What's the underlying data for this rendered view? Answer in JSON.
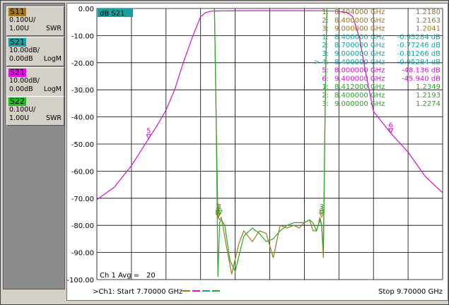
{
  "side_panel": {
    "traces": [
      {
        "name": "S11",
        "scale": "0.100U/",
        "ref": "1.00U",
        "format": "SWR",
        "color": "#a47a1c"
      },
      {
        "name": "S21",
        "scale": "10.00dB/",
        "ref": "0.00dB",
        "format": "LogM",
        "color": "#1aa0a0"
      },
      {
        "name": "S21",
        "scale": "10.00dB/",
        "ref": "0.00dB",
        "format": "LogM",
        "color": "#e010e0"
      },
      {
        "name": "S22",
        "scale": "0.100U/",
        "ref": "1.00U",
        "format": "SWR",
        "color": "#22bb22"
      }
    ]
  },
  "plot": {
    "active_trace_label": "dB S21",
    "avg_label": "Ch 1 Avg =",
    "avg_value": "20",
    "start_label": ">Ch1:  Start  7.70000 GHz",
    "stop_label": "Stop  9.70000 GHz"
  },
  "markers": [
    {
      "id": "1:",
      "freq": "8.404000 GHz",
      "value": "1.2180",
      "color": "#a0701a"
    },
    {
      "id": "2:",
      "freq": "8.400000 GHz",
      "value": "1.2163",
      "color": "#a0701a"
    },
    {
      "id": "3:",
      "freq": "9.000000 GHz",
      "value": "1.2041",
      "color": "#a0701a"
    },
    {
      "id": "1:",
      "freq": "8.400000 GHz",
      "value": "-0.95284 dB",
      "color": "#1aa0a0"
    },
    {
      "id": "2:",
      "freq": "8.700000 GHz",
      "value": "-0.77246 dB",
      "color": "#1aa0a0"
    },
    {
      "id": "3:",
      "freq": "9.000000 GHz",
      "value": "-0.81266 dB",
      "color": "#1aa0a0"
    },
    {
      "id": "> 4:",
      "freq": "8.400000 GHz",
      "value": "-0.95284 dB",
      "color": "#1aa0a0"
    },
    {
      "id": "5:",
      "freq": "8.000000 GHz",
      "value": "-48.136 dB",
      "color": "#e010e0"
    },
    {
      "id": "6:",
      "freq": "9.400000 GHz",
      "value": "-45.940 dB",
      "color": "#e010e0"
    },
    {
      "id": "1:",
      "freq": "8.412000 GHz",
      "value": "1.2349",
      "color": "#22aa22"
    },
    {
      "id": "2:",
      "freq": "8.400000 GHz",
      "value": "1.2193",
      "color": "#22aa22"
    },
    {
      "id": "3:",
      "freq": "9.000000 GHz",
      "value": "1.2274",
      "color": "#22aa22"
    }
  ],
  "chart_data": {
    "type": "line",
    "xlim": [
      7.7,
      9.7
    ],
    "ylim": [
      -100,
      0
    ],
    "y_ticks": [
      "0.00",
      "-10.00",
      "-20.00",
      "-30.00",
      "-40.00",
      "-50.00",
      "-60.00",
      "-70.00",
      "-80.00",
      "-90.00",
      "-100.00"
    ],
    "grid": true,
    "x_grid_divisions": 10,
    "series": [
      {
        "name": "S21",
        "color": "#d010d0",
        "x": [
          7.7,
          7.8,
          7.9,
          8.0,
          8.05,
          8.1,
          8.15,
          8.2,
          8.25,
          8.3,
          8.33,
          8.36,
          8.39,
          8.41,
          8.6,
          8.8,
          9.0,
          9.1,
          9.15,
          9.18,
          9.22,
          9.25,
          9.3,
          9.4,
          9.5,
          9.6,
          9.7
        ],
        "y": [
          -70.5,
          -66,
          -58,
          -48,
          -43,
          -37.5,
          -30,
          -20,
          -11,
          -3,
          -1.5,
          -1.0,
          -0.95,
          -0.9,
          -0.8,
          -0.8,
          -0.85,
          -1.0,
          -1.5,
          -3,
          -11,
          -22,
          -38,
          -46,
          -53,
          -62,
          -68
        ]
      },
      {
        "name": "S11",
        "color": "#a07818",
        "x": [
          8.38,
          8.39,
          8.4,
          8.41,
          8.42,
          8.45,
          8.48,
          8.52,
          8.55,
          8.6,
          8.64,
          8.68,
          8.72,
          8.76,
          8.8,
          8.84,
          8.87,
          8.9,
          8.93,
          8.95,
          8.97,
          8.98,
          8.99,
          9.0,
          9.01,
          9.02,
          9.03
        ],
        "y": [
          0,
          -40,
          -77,
          -78,
          -77,
          -88,
          -98,
          -87,
          -82,
          -86,
          -82,
          -83,
          -92,
          -80,
          -81,
          -80,
          -81,
          -79,
          -78,
          -82,
          -82,
          -80,
          -77,
          -80,
          -92,
          -40,
          0
        ]
      },
      {
        "name": "S22",
        "color": "#22aa22",
        "x": [
          8.38,
          8.39,
          8.4,
          8.41,
          8.42,
          8.44,
          8.47,
          8.5,
          8.55,
          8.6,
          8.64,
          8.68,
          8.72,
          8.76,
          8.8,
          8.84,
          8.87,
          8.9,
          8.93,
          8.95,
          8.97,
          8.98,
          8.99,
          9.0,
          9.01,
          9.02,
          9.03
        ],
        "y": [
          0,
          -40,
          -99,
          -79,
          -78,
          -80,
          -93,
          -97,
          -84,
          -81,
          -83,
          -86,
          -85,
          -82,
          -80,
          -79,
          -79,
          -79,
          -78,
          -79,
          -82,
          -80,
          -78,
          -80,
          -89,
          -40,
          0
        ]
      }
    ],
    "point_markers": [
      {
        "label": "5",
        "x": 8.0,
        "y": -48.1,
        "color": "#d010d0"
      },
      {
        "label": "6",
        "x": 9.4,
        "y": -45.9,
        "color": "#d010d0"
      },
      {
        "label": "1",
        "x": 8.404,
        "y": -77,
        "color": "#a07818"
      },
      {
        "label": "2",
        "x": 8.4,
        "y": -77,
        "color": "#a07818"
      },
      {
        "label": "3",
        "x": 9.0,
        "y": -77,
        "color": "#a07818"
      },
      {
        "label": "1",
        "x": 8.412,
        "y": -76,
        "color": "#22aa22"
      },
      {
        "label": "2",
        "x": 8.4,
        "y": -76,
        "color": "#22aa22"
      },
      {
        "label": "3",
        "x": 9.0,
        "y": -76,
        "color": "#22aa22"
      }
    ],
    "footer_legend_colors": [
      "#a07818",
      "#e010e0",
      "#1aa0a0",
      "#22aa22"
    ]
  }
}
